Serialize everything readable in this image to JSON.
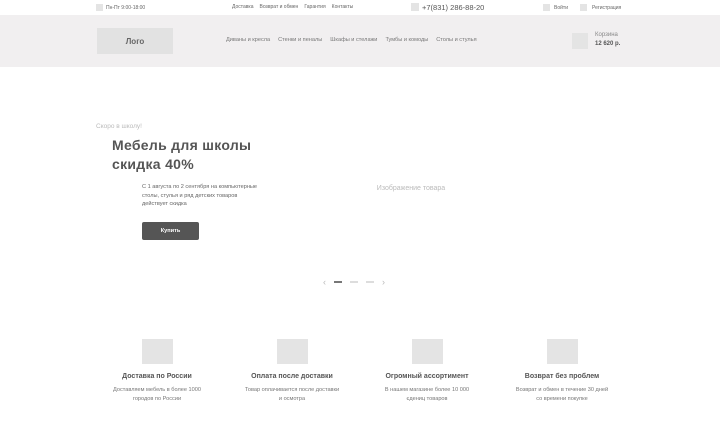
{
  "topbar": {
    "hours": "Пн-Пт 9:00-18:00",
    "links": [
      "Доставка",
      "Возврат и обмен",
      "Гарантия",
      "Контакты"
    ],
    "phone": "+7(831) 286-88-20",
    "login": "Войти",
    "register": "Регистрация"
  },
  "header": {
    "logo": "Лого",
    "nav": [
      "Диваны и кресла",
      "Стенки и пеналы",
      "Шкафы и стелажи",
      "Тумбы и комоды",
      "Столы и стулья"
    ],
    "cart_label": "Корзина",
    "cart_total": "12 620 р."
  },
  "hero": {
    "subtitle": "Скоро в школу!",
    "title_line1": "Мебель для школы",
    "title_line2": "скидка 40%",
    "text_line1": "С 1 августа по 2 сентября на компьютерные",
    "text_line2": "столы, стулья и ряд детских товаров",
    "text_line3": "действует скидка",
    "button": "Купить",
    "image_label": "Изображение товара",
    "slides": 3,
    "active_slide": 1
  },
  "features": [
    {
      "title": "Доставка по России",
      "line1": "Доставляем мебель в более 1000",
      "line2": "городов по России"
    },
    {
      "title": "Оплата после доставки",
      "line1": "Товар оплачивается после доставки",
      "line2": "и осмотра"
    },
    {
      "title": "Огромный ассортимент",
      "line1": "В нашем магазине более 10 000",
      "line2": "єдениц товаров"
    },
    {
      "title": "Возврат без проблем",
      "line1": "Возврат и обмен в течение 30 дней",
      "line2": "со времени покупке"
    }
  ]
}
